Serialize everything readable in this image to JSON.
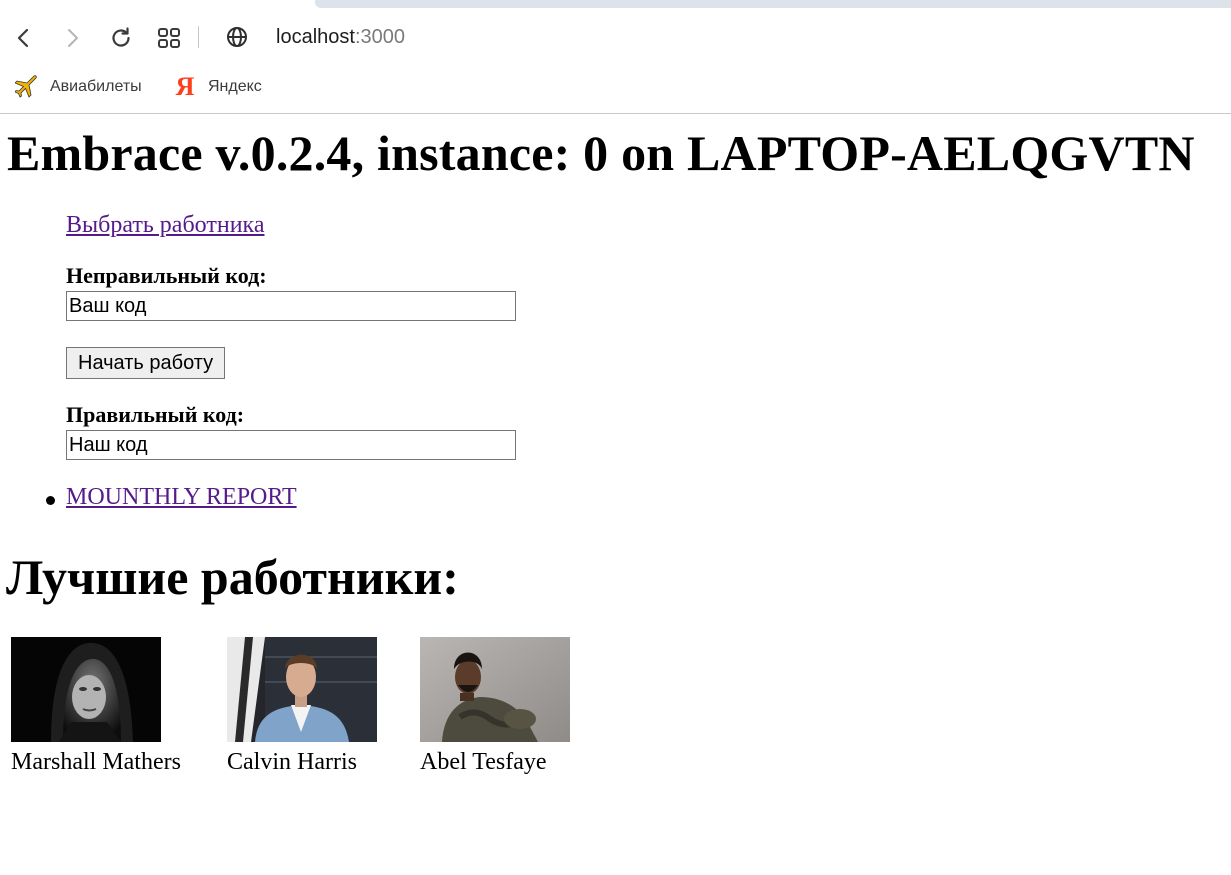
{
  "browser": {
    "url_host": "localhost",
    "url_port": ":3000",
    "bookmarks": [
      {
        "label": "Авиабилеты",
        "icon": "airplane-icon"
      },
      {
        "label": "Яндекс",
        "icon": "yandex-icon",
        "glyph": "Я"
      }
    ]
  },
  "page": {
    "title": "Embrace v.0.2.4, instance: 0 on LAPTOP-AELQGVTN",
    "pick_worker_link": "Выбрать работника",
    "wrong_code": {
      "label": "Неправильный код:",
      "value": "Ваш код"
    },
    "start_button": "Начать работу",
    "right_code": {
      "label": "Правильный код:",
      "value": "Наш код"
    },
    "report_link": "MOUNTHLY REPORT",
    "best_heading": "Лучшие работники:",
    "employees": [
      {
        "name": "Marshall Mathers"
      },
      {
        "name": "Calvin Harris"
      },
      {
        "name": "Abel Tesfaye"
      }
    ]
  },
  "colors": {
    "link": "#551a8b",
    "yandex": "#fc3f1d"
  }
}
